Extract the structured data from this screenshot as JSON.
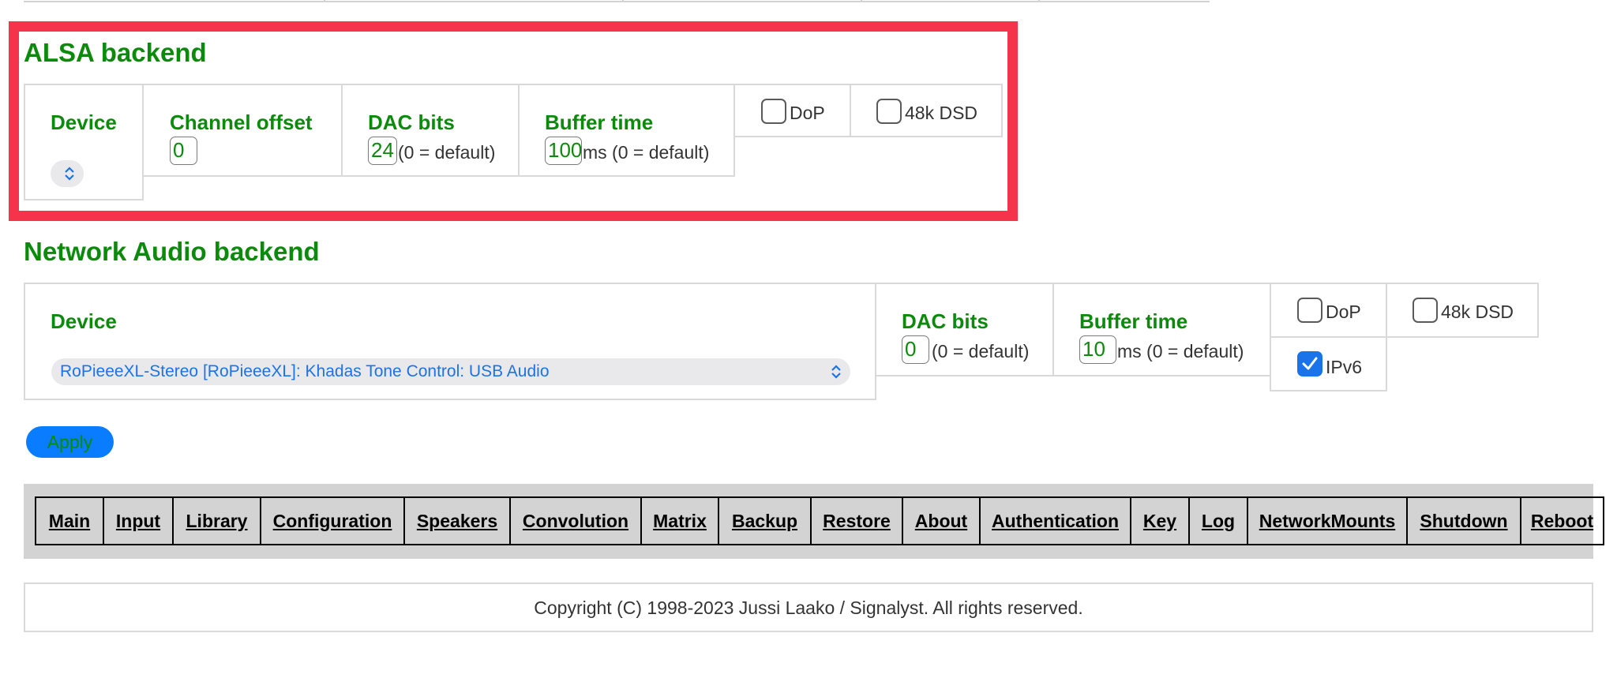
{
  "alsa": {
    "title": "ALSA backend",
    "device_label": "Device",
    "device_value": "",
    "channel_offset_label": "Channel offset",
    "channel_offset_value": "0",
    "dac_bits_label": "DAC bits",
    "dac_bits_value": "24",
    "dac_bits_hint": "(0 = default)",
    "buffer_time_label": "Buffer time",
    "buffer_time_value": "100",
    "buffer_time_hint": "ms (0 = default)",
    "dop_label": "DoP",
    "dop_checked": false,
    "dsd48k_label": "48k DSD",
    "dsd48k_checked": false
  },
  "network_audio": {
    "title": "Network Audio backend",
    "device_label": "Device",
    "device_value": "RoPieeeXL-Stereo [RoPieeeXL]: Khadas Tone Control: USB Audio",
    "dac_bits_label": "DAC bits",
    "dac_bits_value": "0",
    "dac_bits_hint": "(0 = default)",
    "buffer_time_label": "Buffer time",
    "buffer_time_value": "10",
    "buffer_time_hint": "ms (0 = default)",
    "dop_label": "DoP",
    "dop_checked": false,
    "dsd48k_label": "48k DSD",
    "dsd48k_checked": false,
    "ipv6_label": "IPv6",
    "ipv6_checked": true
  },
  "apply_label": "Apply",
  "nav": {
    "items": [
      "Main",
      "Input",
      "Library",
      "Configuration",
      "Speakers",
      "Convolution",
      "Matrix",
      "Backup",
      "Restore",
      "About",
      "Authentication",
      "Key",
      "Log",
      "NetworkMounts",
      "Shutdown",
      "Reboot"
    ]
  },
  "footer": {
    "copyright": "Copyright (C) 1998-2023 Jussi Laako / Signalyst. All rights reserved."
  },
  "colors": {
    "label_green": "#0b8a0b",
    "highlight_red": "#f5334a",
    "accent_blue": "#0a7cff",
    "nav_bg": "#d3d3d3"
  }
}
